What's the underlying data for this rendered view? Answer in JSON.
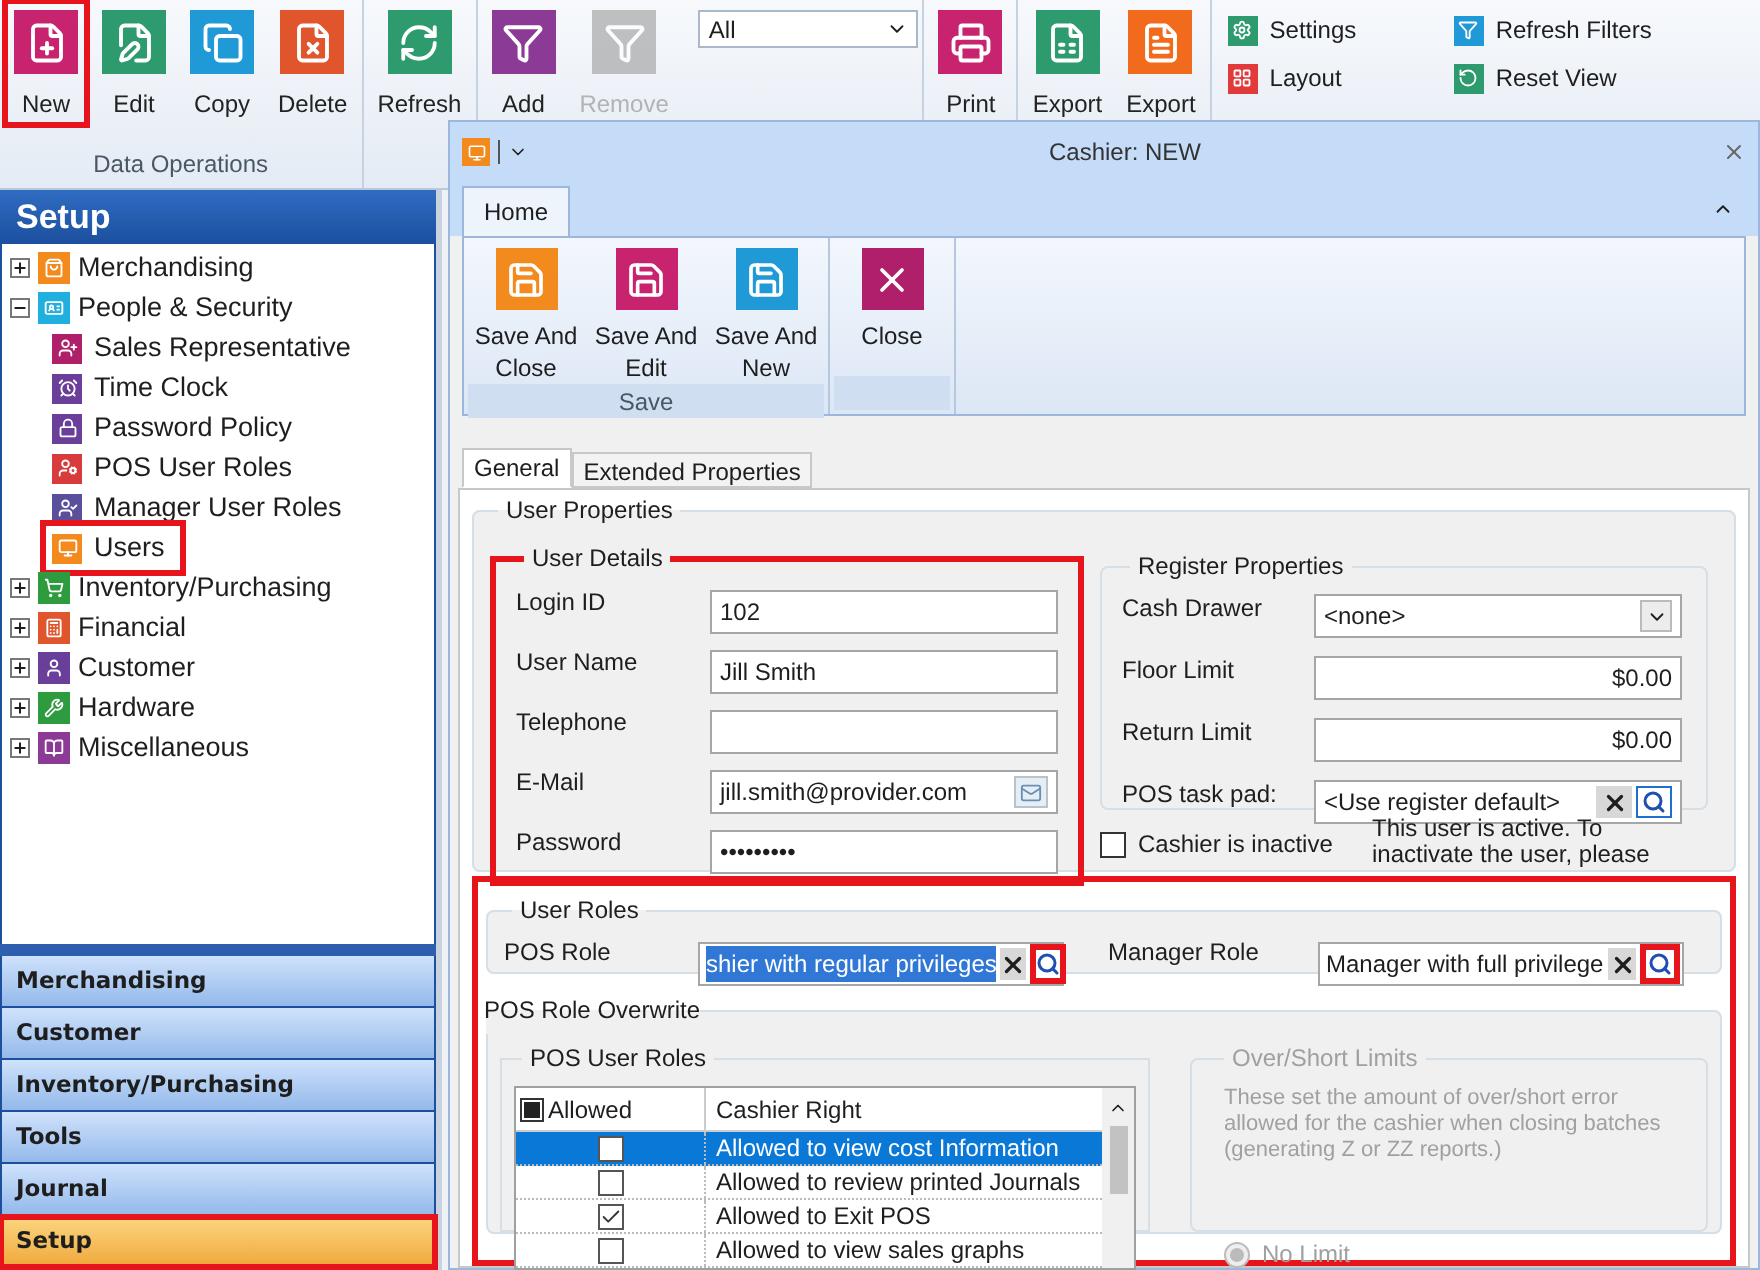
{
  "toolbar": {
    "groups": [
      {
        "label": "Data Operations",
        "buttons": [
          {
            "label": "New",
            "highlighted": true,
            "disabled": false
          },
          {
            "label": "Edit",
            "highlighted": false,
            "disabled": false
          },
          {
            "label": "Copy",
            "highlighted": false,
            "disabled": false
          },
          {
            "label": "Delete",
            "highlighted": false,
            "disabled": false
          }
        ]
      },
      {
        "buttons": [
          {
            "label": "Refresh",
            "highlighted": false,
            "disabled": false
          }
        ]
      },
      {
        "buttons": [
          {
            "label": "Add",
            "highlighted": false,
            "disabled": false
          },
          {
            "label": "Remove",
            "highlighted": false,
            "disabled": true
          }
        ],
        "filter": "All"
      },
      {
        "buttons": [
          {
            "label": "Print",
            "highlighted": false,
            "disabled": false
          }
        ]
      },
      {
        "buttons": [
          {
            "label": "Export",
            "highlighted": false,
            "disabled": false
          },
          {
            "label": "Export",
            "highlighted": false,
            "disabled": false
          }
        ]
      }
    ],
    "small_buttons": [
      {
        "label": "Settings"
      },
      {
        "label": "Refresh Filters"
      },
      {
        "label": "Layout"
      },
      {
        "label": "Reset View"
      }
    ]
  },
  "sidebar": {
    "title": "Setup",
    "tree": [
      {
        "label": "Merchandising",
        "expanded": false
      },
      {
        "label": "People & Security",
        "expanded": true,
        "children": [
          {
            "label": "Sales Representative",
            "highlighted": false
          },
          {
            "label": "Time Clock",
            "highlighted": false
          },
          {
            "label": "Password Policy",
            "highlighted": false
          },
          {
            "label": "POS User Roles",
            "highlighted": false
          },
          {
            "label": "Manager User Roles",
            "highlighted": false
          },
          {
            "label": "Users",
            "highlighted": true
          }
        ]
      },
      {
        "label": "Inventory/Purchasing",
        "expanded": false
      },
      {
        "label": "Financial",
        "expanded": false
      },
      {
        "label": "Customer",
        "expanded": false
      },
      {
        "label": "Hardware",
        "expanded": false
      },
      {
        "label": "Miscellaneous",
        "expanded": false
      }
    ],
    "nav": [
      {
        "label": "Merchandising",
        "selected": false,
        "highlighted": false
      },
      {
        "label": "Customer",
        "selected": false,
        "highlighted": false
      },
      {
        "label": "Inventory/Purchasing",
        "selected": false,
        "highlighted": false
      },
      {
        "label": "Tools",
        "selected": false,
        "highlighted": false
      },
      {
        "label": "Journal",
        "selected": false,
        "highlighted": false
      },
      {
        "label": "Setup",
        "selected": true,
        "highlighted": true
      }
    ]
  },
  "dialog": {
    "title": "Cashier: NEW",
    "ribbon_tabs": [
      {
        "label": "Home",
        "selected": true
      }
    ],
    "ribbon_groups": [
      {
        "label": "Save",
        "buttons": [
          {
            "label": "Save And Close"
          },
          {
            "label": "Save And Edit"
          },
          {
            "label": "Save And New"
          }
        ]
      },
      {
        "buttons": [
          {
            "label": "Close"
          }
        ]
      }
    ],
    "tabs": [
      {
        "label": "General",
        "selected": true
      },
      {
        "label": "Extended Properties",
        "selected": false
      }
    ],
    "user_properties": {
      "title": "User Properties",
      "user_details": {
        "title": "User Details",
        "highlighted": true,
        "fields": [
          {
            "label": "Login ID",
            "value": "102",
            "kind": "text"
          },
          {
            "label": "User Name",
            "value": "Jill Smith",
            "kind": "text"
          },
          {
            "label": "Telephone",
            "kind": "text"
          },
          {
            "label": "E-Mail",
            "value": "jill.smith@provider.com",
            "kind": "email"
          },
          {
            "label": "Password",
            "value": "•••••••••",
            "kind": "text"
          }
        ]
      },
      "register_properties": {
        "title": "Register Properties",
        "fields": [
          {
            "label": "Cash Drawer",
            "value": "<none>",
            "kind": "dropdown"
          },
          {
            "label": "Floor Limit",
            "value": "$0.00",
            "kind": "amount"
          },
          {
            "label": "Return Limit",
            "value": "$0.00",
            "kind": "amount"
          },
          {
            "label": "POS task pad:",
            "value": "<Use register default>",
            "kind": "lookup"
          }
        ]
      },
      "inactive": {
        "label": "Cashier is inactive",
        "checked": false
      },
      "note": "This user is active.  To inactivate the user, please"
    },
    "user_roles": {
      "title": "User Roles",
      "highlighted": true,
      "roles": [
        {
          "label": "POS Role",
          "value": "shier with regular privileges",
          "text_selected": true,
          "search_highlighted": true
        },
        {
          "label": "Manager Role",
          "value": "Manager with full privilege",
          "text_selected": false,
          "search_highlighted": true
        }
      ]
    },
    "pos_role_overwrite": {
      "title": "POS Role Overwrite",
      "highlighted": true,
      "grid": {
        "title": "POS User Roles",
        "header_indeterminate": true,
        "columns": [
          "Allowed",
          "Cashier Right"
        ],
        "rows": [
          {
            "checked": false,
            "right": "Allowed to view cost Information",
            "selected": true
          },
          {
            "checked": false,
            "right": "Allowed to review printed Journals",
            "selected": false
          },
          {
            "checked": true,
            "right": "Allowed to Exit POS",
            "selected": false
          },
          {
            "checked": false,
            "right": "Allowed to view sales graphs",
            "selected": false
          }
        ]
      },
      "over_short": {
        "title": "Over/Short Limits",
        "disabled": true,
        "text": "These set the amount of over/short error allowed for the cashier when closing batches (generating Z or ZZ reports.)",
        "options": [
          {
            "label": "No Limit",
            "selected": true
          }
        ]
      }
    }
  }
}
